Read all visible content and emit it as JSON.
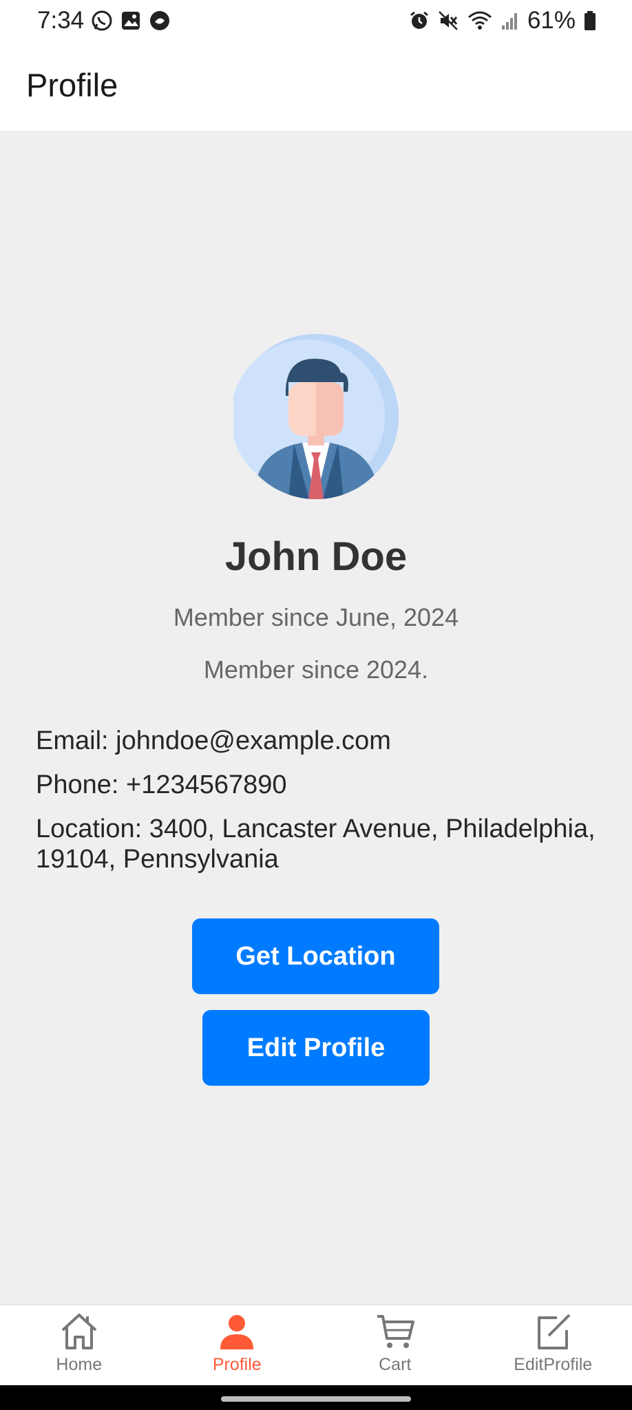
{
  "status_bar": {
    "time": "7:34",
    "battery_percent": "61%",
    "left_icons": [
      "whatsapp-icon",
      "gallery-icon",
      "app-notification-icon"
    ],
    "right_icons": [
      "alarm-icon",
      "mute-icon",
      "wifi-icon",
      "signal-icon",
      "battery-icon"
    ]
  },
  "header": {
    "title": "Profile"
  },
  "profile": {
    "name": "John Doe",
    "member_since_1": "Member since June, 2024",
    "member_since_2": "Member since 2024.",
    "email": "Email: johndoe@example.com",
    "phone": "Phone: +1234567890",
    "location": "Location: 3400, Lancaster Avenue, Philadelphia, 19104, Pennsylvania"
  },
  "buttons": {
    "get_location": "Get Location",
    "edit_profile": "Edit Profile"
  },
  "nav": {
    "items": [
      {
        "label": "Home",
        "icon": "home-icon",
        "active": false
      },
      {
        "label": "Profile",
        "icon": "person-icon",
        "active": true
      },
      {
        "label": "Cart",
        "icon": "cart-icon",
        "active": false
      },
      {
        "label": "EditProfile",
        "icon": "edit-icon",
        "active": false
      }
    ]
  },
  "colors": {
    "accent": "#007bff",
    "active_nav": "#ff5a36",
    "background": "#efefef"
  }
}
